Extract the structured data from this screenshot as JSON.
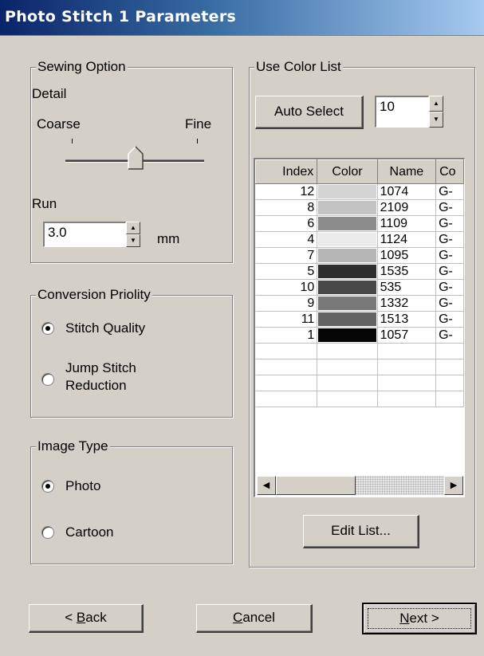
{
  "window": {
    "title": "Photo Stitch 1 Parameters"
  },
  "sewing_option": {
    "legend": "Sewing Option",
    "detail_label": "Detail",
    "coarse_label": "Coarse",
    "fine_label": "Fine",
    "detail_level": 0.5,
    "run_label": "Run",
    "run_value": "3.0",
    "run_unit": "mm"
  },
  "conversion_priority": {
    "legend": "Conversion Priolity",
    "options": [
      {
        "label": "Stitch Quality",
        "selected": true
      },
      {
        "label_line1": "Jump Stitch",
        "label_line2": "Reduction",
        "selected": false
      }
    ]
  },
  "image_type": {
    "legend": "Image Type",
    "options": [
      {
        "label": "Photo",
        "selected": true
      },
      {
        "label": "Cartoon",
        "selected": false
      }
    ]
  },
  "color_list": {
    "legend": "Use Color List",
    "auto_select_label": "Auto Select",
    "count_value": "10",
    "columns": [
      "Index",
      "Color",
      "Name",
      "Co"
    ],
    "rows": [
      {
        "index": "12",
        "color": "#d4d4d4",
        "name": "1074",
        "code": "G-"
      },
      {
        "index": "8",
        "color": "#c3c3c3",
        "name": "2109",
        "code": "G-"
      },
      {
        "index": "6",
        "color": "#8c8c8c",
        "name": "1109",
        "code": "G-"
      },
      {
        "index": "4",
        "color": "#ebebeb",
        "name": "1124",
        "code": "G-"
      },
      {
        "index": "7",
        "color": "#b5b5b5",
        "name": "1095",
        "code": "G-"
      },
      {
        "index": "5",
        "color": "#2e2e2e",
        "name": "1535",
        "code": "G-"
      },
      {
        "index": "10",
        "color": "#474747",
        "name": "535",
        "code": "G-"
      },
      {
        "index": "9",
        "color": "#797979",
        "name": "1332",
        "code": "G-"
      },
      {
        "index": "11",
        "color": "#636363",
        "name": "1513",
        "code": "G-"
      },
      {
        "index": "1",
        "color": "#050505",
        "name": "1057",
        "code": "G-"
      }
    ],
    "edit_list_label": "Edit List..."
  },
  "footer": {
    "back_prefix": "< ",
    "back_key": "B",
    "back_rest": "ack",
    "cancel_key": "C",
    "cancel_rest": "ancel",
    "next_key": "N",
    "next_rest": "ext >"
  }
}
